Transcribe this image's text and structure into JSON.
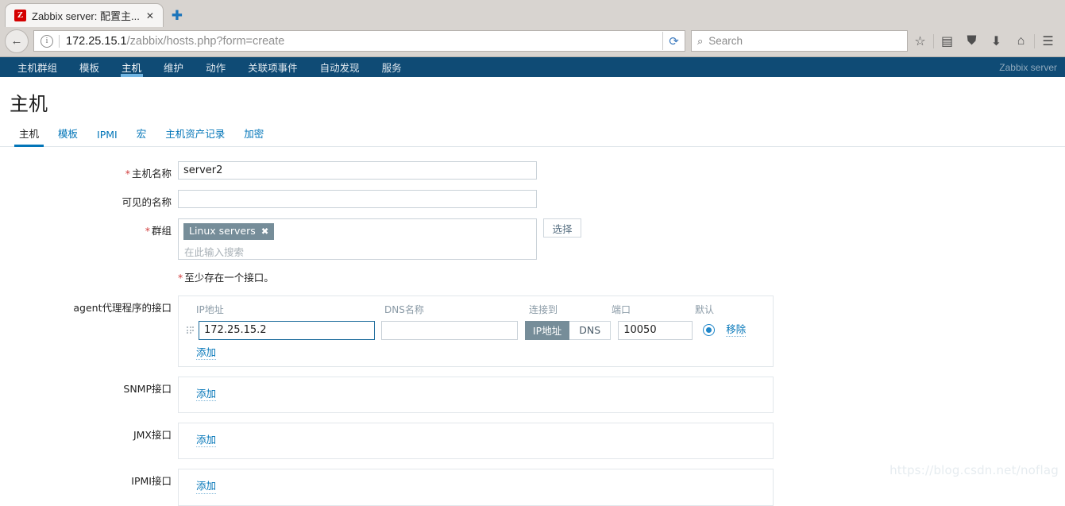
{
  "browser": {
    "tab": {
      "favicon_letter": "Z",
      "title": "Zabbix server: 配置主...",
      "close_label": "✕"
    },
    "newtab_label": "✚",
    "back_icon": "←",
    "url": {
      "host": "172.25.15.1",
      "path": "/zabbix/hosts.php?form=create"
    },
    "reload_icon": "⟳",
    "search": {
      "icon": "⌕",
      "placeholder": "Search"
    },
    "icons": [
      "bookmark-star",
      "reader",
      "pocket",
      "downloads",
      "home",
      "menu"
    ],
    "icon_glyphs": {
      "bookmark_star": "☆",
      "reader": "▤",
      "pocket": "⛊",
      "downloads": "⬇",
      "home": "⌂",
      "menu": "☰"
    }
  },
  "zabbix_nav": {
    "items": [
      {
        "label": "主机群组",
        "active": false
      },
      {
        "label": "模板",
        "active": false
      },
      {
        "label": "主机",
        "active": true
      },
      {
        "label": "维护",
        "active": false
      },
      {
        "label": "动作",
        "active": false
      },
      {
        "label": "关联项事件",
        "active": false
      },
      {
        "label": "自动发现",
        "active": false
      },
      {
        "label": "服务",
        "active": false
      }
    ],
    "server_label": "Zabbix server"
  },
  "page": {
    "title": "主机",
    "tabs": [
      {
        "label": "主机",
        "active": true
      },
      {
        "label": "模板",
        "active": false
      },
      {
        "label": "IPMI",
        "active": false
      },
      {
        "label": "宏",
        "active": false
      },
      {
        "label": "主机资产记录",
        "active": false
      },
      {
        "label": "加密",
        "active": false
      }
    ]
  },
  "form": {
    "host_name": {
      "label": "主机名称",
      "required": "*",
      "value": "server2"
    },
    "visible_name": {
      "label": "可见的名称",
      "value": ""
    },
    "groups": {
      "label": "群组",
      "required": "*",
      "chips": [
        {
          "text": "Linux servers",
          "remove": "✖"
        }
      ],
      "placeholder": "在此输入搜索",
      "select_button": "选择"
    },
    "interface_note": {
      "required": "*",
      "text": "至少存在一个接口。"
    },
    "agent_interface": {
      "label": "agent代理程序的接口",
      "columns": {
        "ip": "IP地址",
        "dns": "DNS名称",
        "connect_to": "连接到",
        "port": "端口",
        "default": "默认"
      },
      "rows": [
        {
          "ip": "172.25.15.2",
          "dns": "",
          "connect_to_options": [
            "IP地址",
            "DNS"
          ],
          "connect_to_selected": "IP地址",
          "port": "10050",
          "is_default": true,
          "remove_label": "移除"
        }
      ],
      "add_label": "添加"
    },
    "snmp_interface": {
      "label": "SNMP接口",
      "add_label": "添加"
    },
    "jmx_interface": {
      "label": "JMX接口",
      "add_label": "添加"
    },
    "ipmi_interface": {
      "label": "IPMI接口",
      "add_label": "添加"
    }
  },
  "watermark": "https://blog.csdn.net/noflag",
  "colors": {
    "nav_bg": "#0f4b75",
    "accent_link": "#0275b8",
    "chip_bg": "#768d99",
    "required_red": "#d13d3d",
    "focus_border": "#1b6a9b"
  }
}
